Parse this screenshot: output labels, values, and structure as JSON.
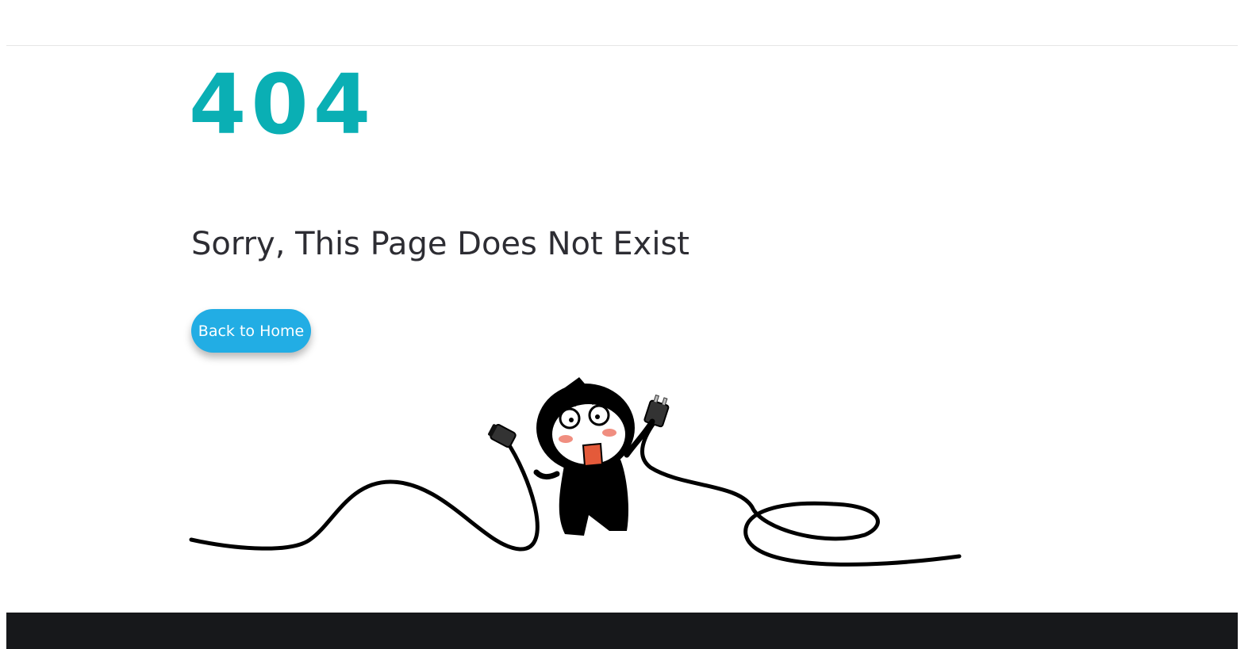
{
  "error": {
    "code": "404",
    "message": "Sorry, This Page Does Not Exist"
  },
  "actions": {
    "home_label": "Back to Home"
  },
  "illustration": {
    "subject": "character-holding-unplugged-cable"
  },
  "colors": {
    "code": "#0aafb4",
    "message": "#2d2d33",
    "button": "#22ade4",
    "footer": "#17181b"
  }
}
